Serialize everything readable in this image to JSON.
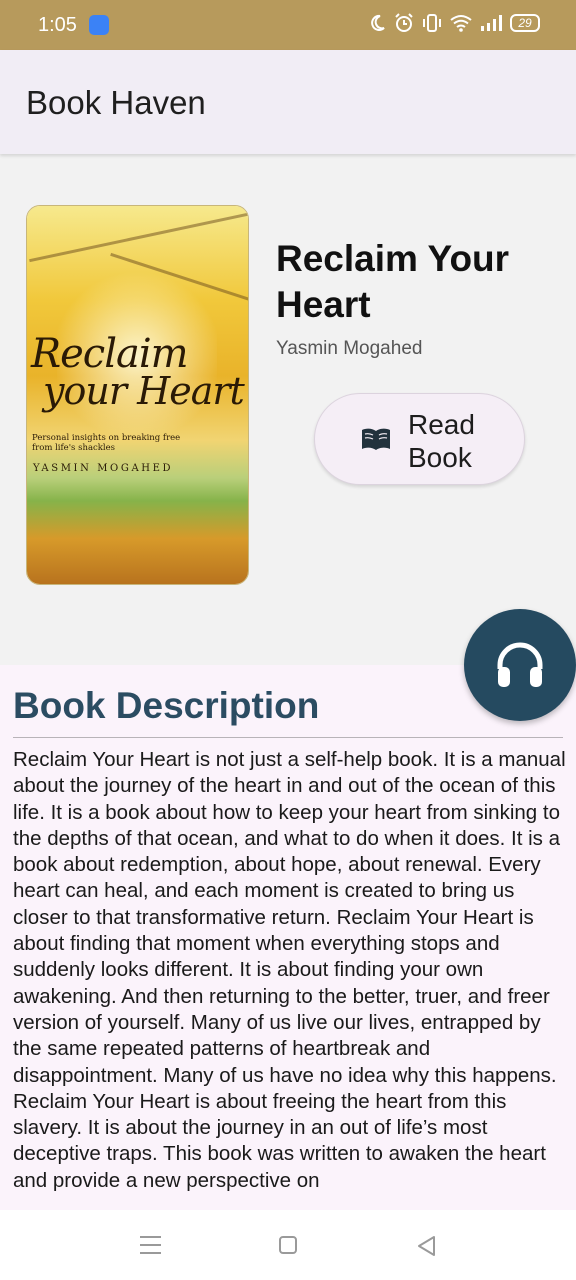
{
  "status_bar": {
    "time": "1:05",
    "battery": "29",
    "icons": [
      "android-app-icon",
      "moon-icon",
      "alarm-icon",
      "vibrate-icon",
      "wifi-icon",
      "signal-icon",
      "battery-icon"
    ]
  },
  "app_bar": {
    "title": "Book Haven"
  },
  "book": {
    "title": "Reclaim Your Heart",
    "author": "Yasmin Mogahed",
    "cover": {
      "title_line1": "Reclaim",
      "title_line2": "your Heart",
      "subtitle": "Personal insights on breaking free from life's shackles",
      "author": "YASMIN MOGAHED"
    }
  },
  "actions": {
    "read_label": "Read Book",
    "read_icon": "open-book-icon",
    "audio_icon": "headphones-icon"
  },
  "description": {
    "heading": "Book Description",
    "text": "Reclaim Your Heart is not just a self-help book. It is a manual about the journey of the heart in and out of the ocean of this life. It is a book about how to keep your heart from sinking to the depths of that ocean, and what to do when it does. It is a book about redemption, about hope, about renewal. Every heart can heal, and each moment is created to bring us closer to that transformative return. Reclaim Your Heart is about finding that moment when everything stops and suddenly looks different. It is about finding your own awakening. And then returning to the better, truer, and freer version of yourself. Many of us live our lives, entrapped by the same repeated patterns of heartbreak and disappointment. Many of us have no idea why this happens. Reclaim Your Heart is about freeing the heart from this slavery. It is about the journey in an out of life’s most deceptive traps. This book was written to awaken the heart and provide a new perspective on"
  },
  "colors": {
    "status_bar": "#b79a5c",
    "app_bar": "#f1edf5",
    "heading": "#2b4c62",
    "fab": "#254a60",
    "panel": "#fbf3fb"
  }
}
